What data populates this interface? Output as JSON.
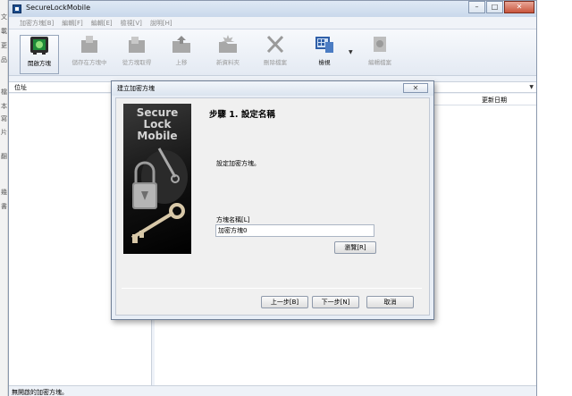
{
  "desktop": {
    "edge_chars": [
      "文",
      "載",
      "更",
      "品",
      "檔",
      "本",
      "寫",
      "片",
      "翻",
      "幾",
      "書"
    ]
  },
  "window": {
    "title": "SecureLockMobile",
    "buttons": {
      "minimize": "–",
      "maximize": "□",
      "close": "✕"
    }
  },
  "menu": [
    "加密方塊[B]",
    "編輯[F]",
    "編輯[E]",
    "檢視[V]",
    "說明[H]"
  ],
  "toolbar": [
    {
      "label": "開啟方塊",
      "icon": "open-vault-icon",
      "enabled": true
    },
    {
      "label": "儲存在方塊中",
      "icon": "store-file-icon",
      "enabled": false
    },
    {
      "label": "從方塊取得",
      "icon": "retrieve-file-icon",
      "enabled": false
    },
    {
      "label": "上移",
      "icon": "folder-up-icon",
      "enabled": false
    },
    {
      "label": "新資料夾",
      "icon": "new-folder-icon",
      "enabled": false
    },
    {
      "label": "刪除檔案",
      "icon": "delete-icon",
      "enabled": false
    },
    {
      "label": "檢視",
      "icon": "view-icon",
      "enabled": true
    },
    {
      "label": "編輯檔案",
      "icon": "edit-file-icon",
      "enabled": false
    }
  ],
  "address": {
    "label": "位址"
  },
  "list": {
    "columns": {
      "modified": "更新日期"
    }
  },
  "status": {
    "text": "無開啟的加密方塊。"
  },
  "dialog": {
    "title": "建立加密方塊",
    "close": "✕",
    "splash": {
      "line1": "Secure",
      "line2": "Lock",
      "line3": "Mobile"
    },
    "step_title": "步驟 1. 設定名稱",
    "description": "設定加密方塊。",
    "name_label": "方塊名稱[L]",
    "name_value": "加密方塊0",
    "browse_label": "瀏覽[R]",
    "back_label": "上一步[B]",
    "next_label": "下一步[N]",
    "cancel_label": "取消"
  },
  "colors": {
    "accent": "#1e4f8f",
    "disabled_text": "#9a9a9a",
    "dialog_bg": "#f0f0f0"
  }
}
